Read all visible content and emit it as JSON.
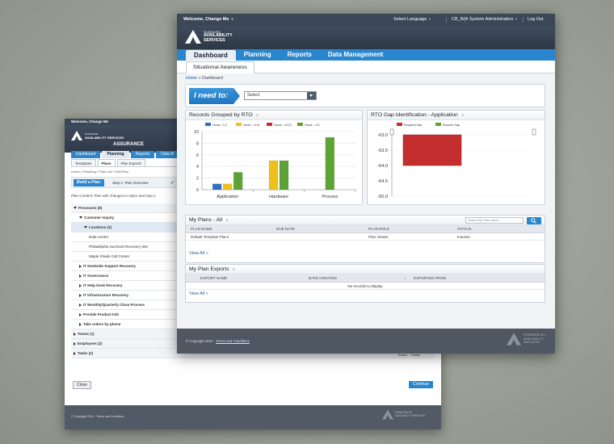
{
  "back_window": {
    "welcome": "Welcome, Change Me",
    "logo_small": "SUNGARD",
    "logo_main": "AVAILABILITY SERVICES",
    "product": "ASSURANCE",
    "nav": [
      "Dashboard",
      "Planning",
      "Reports",
      "Data M"
    ],
    "subtabs": [
      "Templates",
      "Plans",
      "Plan Exports"
    ],
    "breadcrumb": "Home » Planning » Plan List » Edit Plan",
    "build_label": "Build a Plan:",
    "step1": "Step 1: Plan Overview",
    "step2": "Step",
    "content_line": "Plan Content: Plan with changes to step1 and step 2",
    "processes": "Processes (8)",
    "customer_inquiry": "Customer Inquiry",
    "locations": "Locations (3)",
    "locs": [
      "Data Center",
      "Philadelphia SunGard Recovery Site",
      "Maple Shade Call Center"
    ],
    "items": [
      "IT Deskside Support Recovery",
      "IT Governance",
      "IT Help Desk Recovery",
      "IT Infrastructure Recovery",
      "IT Monthly/Quarterly Close Process",
      "Provide Product Info",
      "Take orders by phone"
    ],
    "teams": "Teams (1)",
    "employees": "Employees (2)",
    "tasks": "Tasks (2)",
    "select": "Select",
    "create": "Create",
    "close": "Close",
    "continue": "Continue",
    "copyright": "© Copyright 2014 · Terms and Conditions",
    "powered": "POWERED BY",
    "footer_logo": "AVAILABILITY SERVICES"
  },
  "front_window": {
    "welcome": "Welcome, Change Me",
    "select_language": "Select Language",
    "cb": "CB_IMA",
    "sys_admin": "System Administration",
    "logout": "Log Out",
    "logo_small": "SUNGARD",
    "logo_l1": "AVAILABILITY",
    "logo_l2": "SERVICES",
    "nav": [
      "Dashboard",
      "Planning",
      "Reports",
      "Data Management"
    ],
    "subtab": "Situational Awareness",
    "breadcrumb_home": "Home",
    "breadcrumb_current": "Dashboard",
    "ineed_label": "I need to:",
    "ineed_select": "Select",
    "chart1_title": "Records Grouped by RTO",
    "chart2_title": "RTO Gap Identification - Application",
    "plans_title": "My Plans - All",
    "plans_search_placeholder": "Search By Plan name",
    "plans_cols": [
      "PLAN NAME",
      "DUE DATE",
      "PLAN ROLE",
      "STATUS"
    ],
    "plans_rows": [
      [
        "Default Template Plan1",
        "",
        "Plan Viewer",
        "Inactive"
      ]
    ],
    "view_all": "View All",
    "exports_title": "My Plan Exports",
    "exports_cols": [
      "EXPORT NAME",
      "DATE CREATED",
      "EXPORTED FROM"
    ],
    "exports_empty": "No records to display",
    "copyright": "© Copyright 2014 -",
    "terms": "Terms and Conditions",
    "powered": "POWERED BY",
    "footer_l1": "AVAILABILITY",
    "footer_l2": "SERVICES"
  },
  "chart_data": [
    {
      "type": "bar",
      "title": "Records Grouped by RTO",
      "categories": [
        "Application",
        "Hardware",
        "Process"
      ],
      "series": [
        {
          "name": "Hours : 0-4",
          "color": "#2f6fc4",
          "values": [
            1,
            0,
            0
          ]
        },
        {
          "name": "Hours : >4-8",
          "color": "#f0c01a",
          "values": [
            1,
            5,
            0
          ]
        },
        {
          "name": "Hours : >8-12",
          "color": "#c42e2e",
          "values": [
            0,
            0,
            0
          ]
        },
        {
          "name": "Hours : >12",
          "color": "#5da234",
          "values": [
            3,
            5,
            9
          ]
        }
      ],
      "ylim": [
        0,
        10
      ],
      "yticks": [
        0,
        2,
        4,
        6,
        8,
        10
      ],
      "grid": true,
      "legend": "top"
    },
    {
      "type": "bar",
      "title": "RTO Gap Identification - Application",
      "series": [
        {
          "name": "Required Gap",
          "color": "#c42e2e",
          "range": [
            -63.0,
            -64.0
          ]
        },
        {
          "name": "Recover Gap",
          "color": "#5da234"
        }
      ],
      "ylim": [
        -65.0,
        -63.0
      ],
      "yticks": [
        "-63.0",
        "-63.5",
        "-64.0",
        "-64.5",
        "-65.0"
      ],
      "legend": "top"
    }
  ]
}
